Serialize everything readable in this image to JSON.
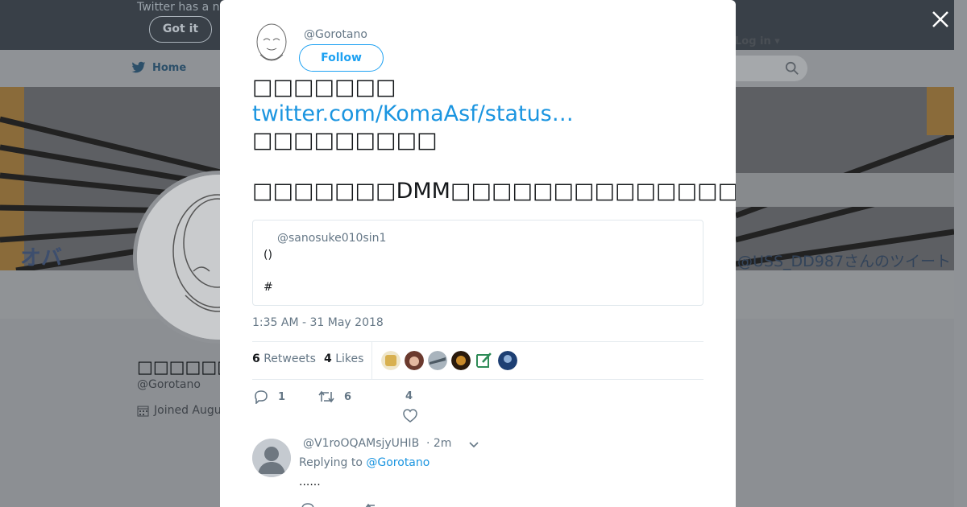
{
  "topbar": {
    "notice": "Twitter has a n",
    "got_it": "Got it"
  },
  "nav": {
    "home": "Home",
    "login": "Log in"
  },
  "banner": {
    "left_text": "オバ",
    "right_text": "@USS_DD987さんのツイート"
  },
  "profile": {
    "name": "□□□□□□□",
    "handle": "@Gorotano",
    "joined": "Joined Augu"
  },
  "tweet": {
    "handle": "@Gorotano",
    "follow_label": "Follow",
    "line1": "□□□□□□□",
    "link": "twitter.com/KomaAsf/status…",
    "line2": "□□□□□□□□□",
    "line3": "□□□□□□□DMM□□□□□□□□□□□□□□□□□□□□□",
    "quote_handle": "@sanosuke010sin1",
    "quote_line1": "()",
    "quote_line2": "#",
    "timestamp": "1:35 AM - 31 May 2018",
    "retweets_count": "6",
    "retweets_label": "Retweets",
    "likes_count": "4",
    "likes_label": "Likes",
    "reply_count": "1",
    "retweet_action_count": "6",
    "like_action_count": "4"
  },
  "reply": {
    "handle": "@V1roOQAMsjyUHIB",
    "time": "· 2m",
    "replying_prefix": "Replying to",
    "replying_to": "@Gorotano",
    "body": "......"
  },
  "colors": {
    "accent": "#1da1f2",
    "link": "#1b95e0",
    "text": "#14171a",
    "muted": "#657786"
  }
}
